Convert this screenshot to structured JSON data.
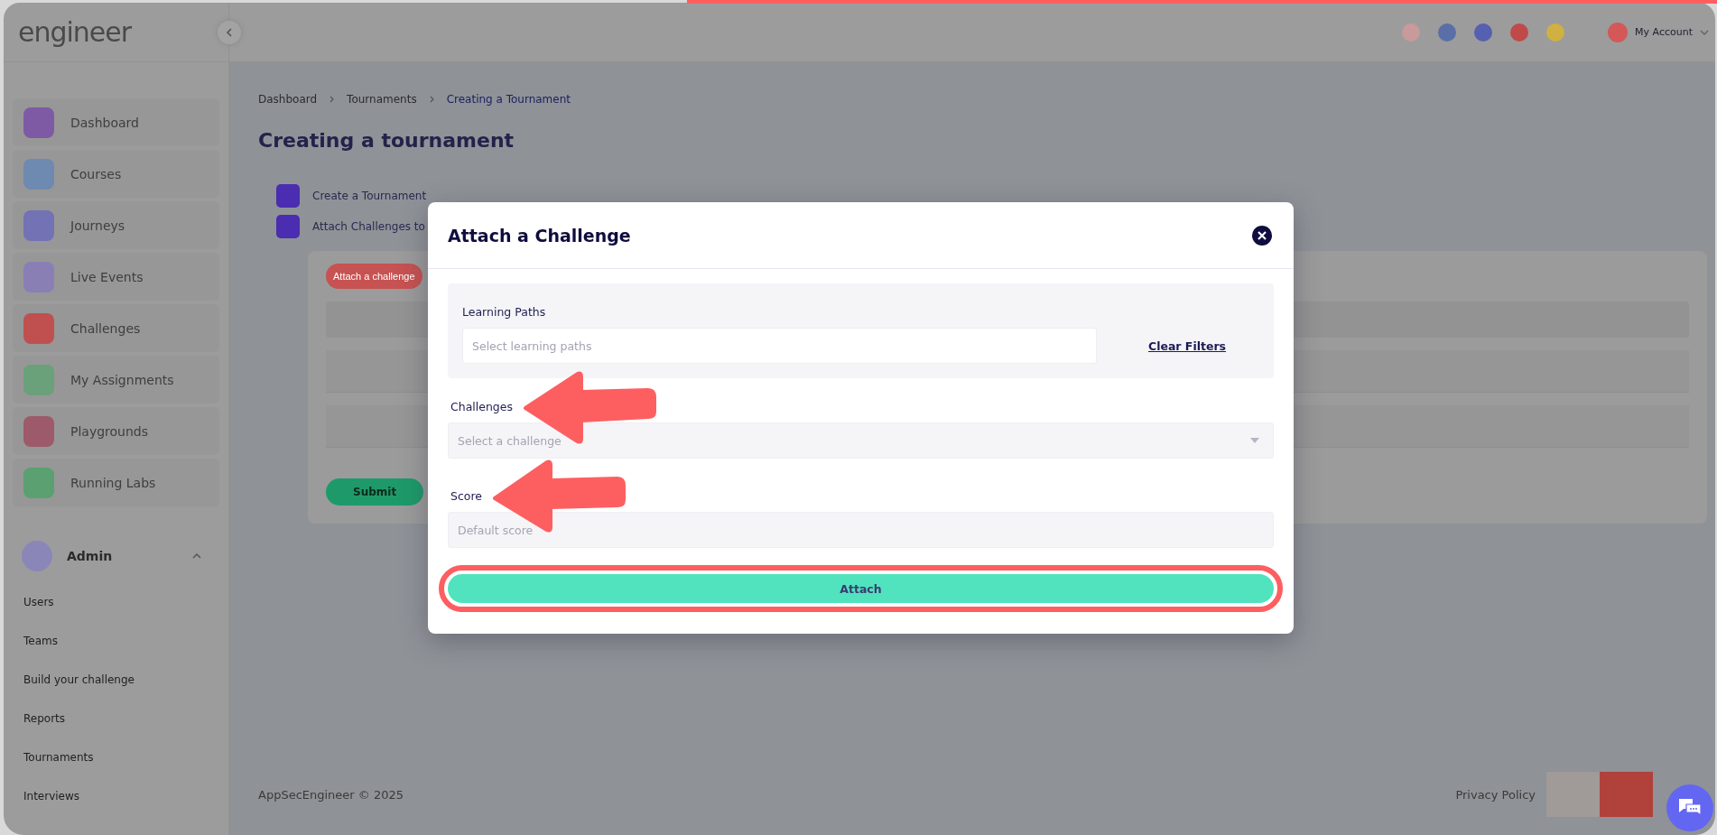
{
  "progress": {
    "level": 0.6
  },
  "header": {
    "logo_text": "engineer",
    "account": "My Account"
  },
  "sidebar": {
    "items": [
      {
        "label": "Dashboard"
      },
      {
        "label": "Courses"
      },
      {
        "label": "Journeys"
      },
      {
        "label": "Live Events"
      },
      {
        "label": "Challenges"
      },
      {
        "label": "My Assignments"
      },
      {
        "label": "Playgrounds"
      },
      {
        "label": "Running Labs"
      }
    ],
    "admin": {
      "label": "Admin",
      "expanded": true,
      "items": [
        "Users",
        "Teams",
        "Build your challenge",
        "Reports",
        "Tournaments",
        "Interviews"
      ]
    }
  },
  "breadcrumb": [
    "Dashboard",
    "Tournaments",
    "Creating a Tournament"
  ],
  "page_title": "Creating a tournament",
  "steps": [
    {
      "label": "Create a Tournament"
    },
    {
      "label": "Attach Challenges to"
    }
  ],
  "card": {
    "attach_button": "Attach a challenge",
    "submit_button": "Submit"
  },
  "footer": {
    "copyright": "AppSecEngineer © 2025",
    "privacy": "Privacy Policy"
  },
  "modal": {
    "title": "Attach a Challenge",
    "learning_paths": {
      "label": "Learning Paths",
      "placeholder": "Select learning paths"
    },
    "clear_filters": "Clear Filters",
    "challenges": {
      "label": "Challenges",
      "placeholder": "Select a challenge"
    },
    "score": {
      "label": "Score",
      "placeholder": "Default score"
    },
    "attach_button": "Attach"
  }
}
